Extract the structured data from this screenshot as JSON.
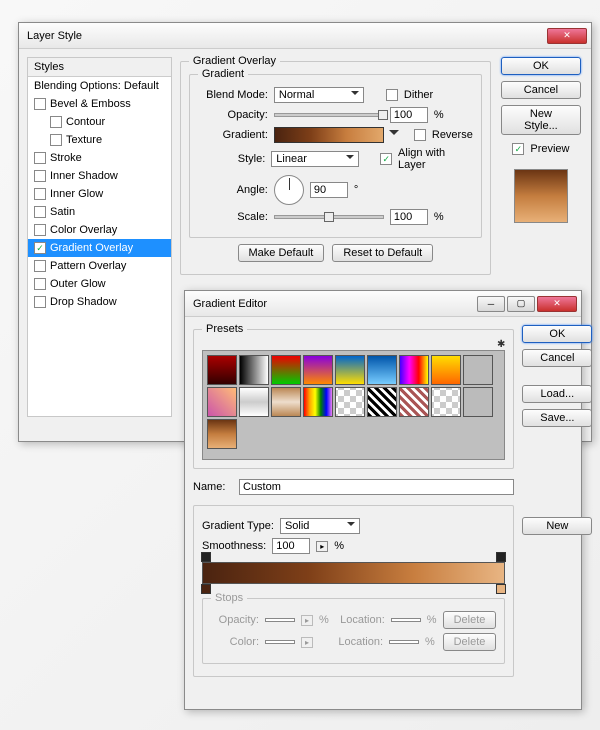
{
  "layerStyle": {
    "title": "Layer Style",
    "stylesHeader": "Styles",
    "blendingOptions": "Blending Options: Default",
    "items": [
      {
        "label": "Bevel & Emboss",
        "checked": false
      },
      {
        "label": "Contour",
        "checked": false,
        "sub": true
      },
      {
        "label": "Texture",
        "checked": false,
        "sub": true
      },
      {
        "label": "Stroke",
        "checked": false
      },
      {
        "label": "Inner Shadow",
        "checked": false
      },
      {
        "label": "Inner Glow",
        "checked": false
      },
      {
        "label": "Satin",
        "checked": false
      },
      {
        "label": "Color Overlay",
        "checked": false
      },
      {
        "label": "Gradient Overlay",
        "checked": true,
        "selected": true
      },
      {
        "label": "Pattern Overlay",
        "checked": false
      },
      {
        "label": "Outer Glow",
        "checked": false
      },
      {
        "label": "Drop Shadow",
        "checked": false
      }
    ],
    "panel": {
      "title": "Gradient Overlay",
      "subTitle": "Gradient",
      "blendModeLabel": "Blend Mode:",
      "blendMode": "Normal",
      "ditherLabel": "Dither",
      "opacityLabel": "Opacity:",
      "opacity": "100",
      "pct": "%",
      "gradientLabel": "Gradient:",
      "reverseLabel": "Reverse",
      "styleLabel": "Style:",
      "style": "Linear",
      "alignLabel": "Align with Layer",
      "angleLabel": "Angle:",
      "angle": "90",
      "deg": "°",
      "scaleLabel": "Scale:",
      "scale": "100",
      "makeDefault": "Make Default",
      "resetDefault": "Reset to Default"
    },
    "buttons": {
      "ok": "OK",
      "cancel": "Cancel",
      "newStyle": "New Style...",
      "preview": "Preview"
    }
  },
  "gradientEditor": {
    "title": "Gradient Editor",
    "presetsLabel": "Presets",
    "nameLabel": "Name:",
    "name": "Custom",
    "new": "New",
    "typeLabel": "Gradient Type:",
    "type": "Solid",
    "smoothLabel": "Smoothness:",
    "smooth": "100",
    "pct": "%",
    "stopsLabel": "Stops",
    "opacityLabel": "Opacity:",
    "colorLabel": "Color:",
    "locationLabel": "Location:",
    "delete": "Delete",
    "ok": "OK",
    "cancel": "Cancel",
    "load": "Load...",
    "save": "Save..."
  }
}
